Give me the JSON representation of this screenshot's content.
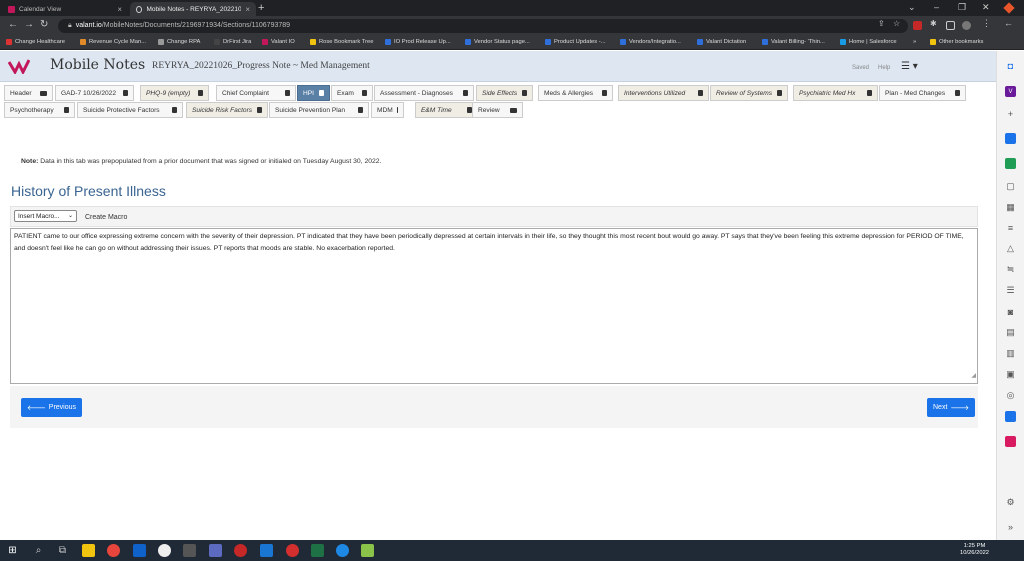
{
  "browser": {
    "tabs": [
      {
        "label": "Calendar View"
      },
      {
        "label": "Mobile Notes - REYRYA_20221026_"
      }
    ],
    "url_host": "valant.io",
    "url_path": "/MobileNotes/Documents/2196971934/Sections/1106793789",
    "bookmarks": [
      {
        "label": "Change Healthcare",
        "color": "#d33"
      },
      {
        "label": "Revenue Cycle Man...",
        "color": "#e08a2a"
      },
      {
        "label": "Change RPA",
        "color": "#999"
      },
      {
        "label": "DrFirst Jira",
        "color": "#444"
      },
      {
        "label": "Valant IO",
        "color": "#c2185b"
      },
      {
        "label": "Rose Bookmark Tree",
        "color": "#f1c40f"
      },
      {
        "label": "IO Prod Release Up...",
        "color": "#2f6fdb"
      },
      {
        "label": "Vendor Status page...",
        "color": "#2f6fdb"
      },
      {
        "label": "Product Updates -...",
        "color": "#2f6fdb"
      },
      {
        "label": "Vendors/Integratio...",
        "color": "#2f6fdb"
      },
      {
        "label": "Valant Dictation",
        "color": "#2f6fdb"
      },
      {
        "label": "Valant Billing- 'Thin...",
        "color": "#2f6fdb"
      },
      {
        "label": "Home | Salesforce",
        "color": "#1a9be6"
      },
      {
        "label": "»",
        "color": ""
      },
      {
        "label": "Other bookmarks",
        "color": "#f1c40f"
      }
    ]
  },
  "app": {
    "brand": "Mobile Notes",
    "document": "REYRYA_20221026_Progress Note ~ Med Management",
    "saved": "Saved",
    "help": "Help"
  },
  "tabs_row1": [
    {
      "label": "Header",
      "italic": false,
      "active": false,
      "icon": "folder"
    },
    {
      "label": "GAD-7 10/26/2022",
      "italic": false,
      "active": false,
      "icon": "trash"
    },
    {
      "label": "PHQ-9 (empty)",
      "italic": true,
      "active": false,
      "icon": "trash"
    },
    {
      "label": "Chief Complaint",
      "italic": false,
      "active": false,
      "icon": "trash"
    },
    {
      "label": "HPI",
      "italic": false,
      "active": true,
      "icon": "trash"
    },
    {
      "label": "Exam",
      "italic": false,
      "active": false,
      "icon": "trash"
    },
    {
      "label": "Assessment - Diagnoses",
      "italic": false,
      "active": false,
      "icon": "trash"
    },
    {
      "label": "Side Effects",
      "italic": true,
      "active": false,
      "icon": "trash"
    },
    {
      "label": "Meds & Allergies",
      "italic": false,
      "active": false,
      "icon": "trash"
    },
    {
      "label": "Interventions Utilized",
      "italic": true,
      "active": false,
      "icon": "trash"
    },
    {
      "label": "Review of Systems",
      "italic": true,
      "active": false,
      "icon": "trash"
    },
    {
      "label": "Psychiatric Med Hx",
      "italic": true,
      "active": false,
      "icon": "trash"
    },
    {
      "label": "Plan - Med Changes",
      "italic": false,
      "active": false,
      "icon": "trash"
    }
  ],
  "tabs_row2": [
    {
      "label": "Psychotherapy",
      "italic": false,
      "active": false,
      "icon": "trash"
    },
    {
      "label": "Suicide Protective Factors",
      "italic": false,
      "active": false,
      "icon": "trash"
    },
    {
      "label": "Suicide Risk Factors",
      "italic": true,
      "active": false,
      "icon": "trash"
    },
    {
      "label": "Suicide Prevention Plan",
      "italic": false,
      "active": false,
      "icon": "trash"
    },
    {
      "label": "MDM",
      "italic": false,
      "active": false,
      "icon": "trash"
    },
    {
      "label": "E&M Time",
      "italic": true,
      "active": false,
      "icon": "trash"
    },
    {
      "label": "Review",
      "italic": false,
      "active": false,
      "icon": "folder"
    }
  ],
  "note": {
    "bold": "Note:",
    "text": " Data in this tab was prepopulated from a prior document that was signed or initialed on Tuesday August 30, 2022."
  },
  "section_title": "History of Present Illness",
  "macro": {
    "select_value": "Insert Macro...",
    "create_label": "Create Macro"
  },
  "hpi_text": "PATIENT came to our office expressing extreme concern with the severity of their depression. PT indicated that they have been periodically depressed at certain intervals in their life, so they thought this most recent bout would go away. PT says that they've been feeling this extreme depression for PERIOD OF TIME, and doesn't feel like he can go on without addressing their issues. PT reports that moods are stable. No exacerbation reported.",
  "buttons": {
    "previous": "Previous",
    "next": "Next"
  },
  "clock": {
    "time": "1:25 PM",
    "date": "10/26/2022"
  }
}
